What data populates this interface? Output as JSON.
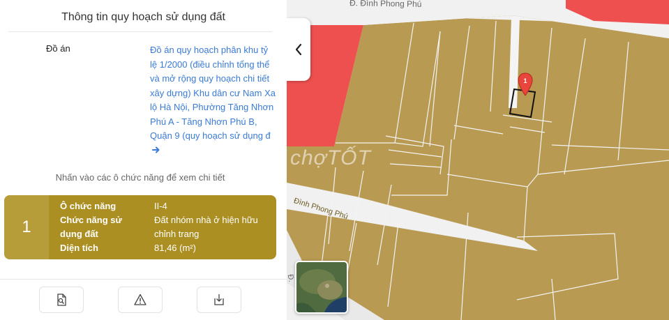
{
  "panel": {
    "title": "Thông tin quy hoạch sử dụng đất",
    "plan_label": "Đồ án",
    "plan_name": "Đồ án quy hoạch phân khu tỷ lệ 1/2000 (điều chỉnh tổng thể và mở rộng quy hoạch chi tiết xây dựng) Khu dân cư Nam Xa lộ Hà Nội, Phường Tăng Nhơn Phú A - Tăng Nhơn Phú B, Quận 9 (quy hoạch sử dụng đ",
    "hint": "Nhấn vào các ô chức năng để xem chi tiết",
    "lot": {
      "index": "1",
      "rows": [
        {
          "key": "Ô chức năng",
          "value": "II-4"
        },
        {
          "key": "Chức năng sử dụng đất",
          "value": "Đất nhóm nhà ở hiện hữu chỉnh trang"
        },
        {
          "key": "Diện tích",
          "value": "81,46 (m²)"
        }
      ]
    },
    "colors": {
      "lot_card": "#ab8f22",
      "link": "#3a7bd5"
    },
    "tools": [
      "document-search-icon",
      "warning-icon",
      "download-icon"
    ]
  },
  "map": {
    "street_top": "Đ. Đình Phong Phú",
    "street_mid": "Đình Phong Phú",
    "street_bottom": "Đ.",
    "watermark": "chợTỐT",
    "marker_label": "1",
    "colors": {
      "residential": "#b89a52",
      "commercial": "#ee5050",
      "road": "#f1f1f1"
    }
  }
}
